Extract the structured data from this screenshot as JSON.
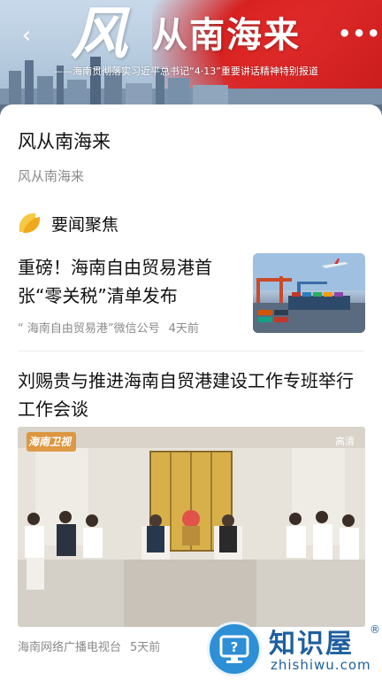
{
  "header": {
    "back_glyph": "‹",
    "more_glyph": "•••",
    "banner_title_first": "风",
    "banner_title_rest": "从南海来",
    "banner_subtitle": "——海南贯彻落实习近平总书记“4·13”重要讲话精神特别报道"
  },
  "page": {
    "title": "风从南海来",
    "subtitle": "风从南海来"
  },
  "section": {
    "title": "要闻聚焦",
    "icon": "leaf-icon",
    "icon_color": "#f5b82e"
  },
  "news": [
    {
      "headline": "重磅！海南自由贸易港首张“零关税”清单发布",
      "source": "“ 海南自由贸易港”微信公号",
      "time": "4天前"
    },
    {
      "headline": "刘赐贵与推进海南自贸港建设工作专班举行工作会谈",
      "source": "海南网络广播电视台",
      "time": "5天前",
      "video_logo": "海南卫视",
      "video_quality": "高清"
    }
  ],
  "watermark": {
    "brand": "知识屋",
    "reg": "®",
    "domain": "zhishiwu.com",
    "badge_glyph": "?"
  },
  "colors": {
    "banner_red": "#d61f1f",
    "accent_blue": "#1e5f9f"
  }
}
